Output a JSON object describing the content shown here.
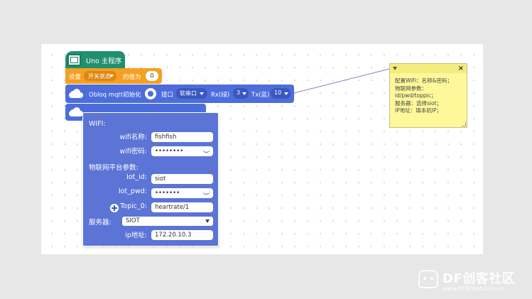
{
  "hat": {
    "icon_text": "UNO",
    "label": "Uno 主程序"
  },
  "set_block": {
    "prefix": "设置",
    "variable": "开关状态",
    "mid": "的值为",
    "value": "0"
  },
  "mqtt_block": {
    "title": "Obloq mqtt初始化",
    "port_label": "接口",
    "port_value": "软串口",
    "rx_label": "Rx(绿)",
    "rx_value": "3",
    "tx_label": "Tx(蓝)",
    "tx_value": "10"
  },
  "popup": {
    "wifi_header": "WIFI:",
    "wifi_name_label": "wifi名称:",
    "wifi_name_value": "fishfish",
    "wifi_pwd_label": "wifi密码:",
    "wifi_pwd_value": "••••••••",
    "iot_header": "物联网平台参数:",
    "iot_id_label": "Iot_id:",
    "iot_id_value": "siot",
    "iot_pwd_label": "Iot_pwd:",
    "iot_pwd_value": "•••••••",
    "topic_label": "Topic_0:",
    "topic_value": "heartrate/1",
    "server_label": "服务器:",
    "server_value": "SIOT",
    "ip_label": "ip地址:",
    "ip_value": "172.20.10.3"
  },
  "comment": {
    "text": "配置WiFi：名称&密码；\n物联网参数：\nid/pwd/toppic；\n服务器：选择siot；\nIP地址：填本机IP；"
  },
  "watermark": {
    "title": "DF创客社区",
    "url": "www.DFRobot.com.cn"
  },
  "colors": {
    "hat": "#20906f",
    "set_block": "#f3a023",
    "iot_block": "#4c6ddb",
    "popup": "#5b74d6",
    "comment": "#fef89b",
    "background": "#e7e7e7"
  }
}
